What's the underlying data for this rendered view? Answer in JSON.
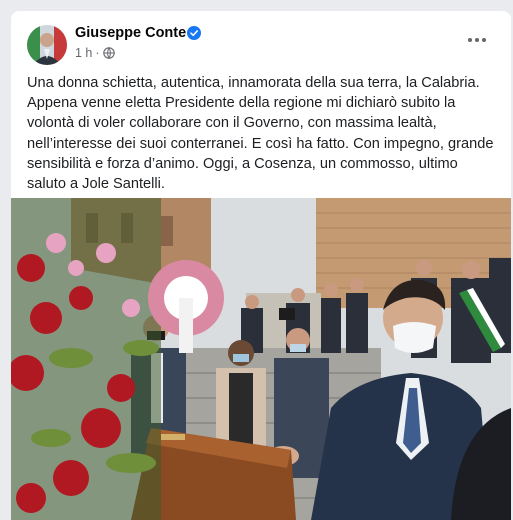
{
  "post": {
    "author": "Giuseppe Conte",
    "timestamp": "1 h",
    "separator": "·",
    "text": "Una donna schietta, autentica, innamorata della sua terra, la Calabria. Appena venne eletta Presidente della regione mi dichiarò subito la volontà di voler collaborare con il Governo, con massima lealtà, nell’interesse dei suoi conterranei. E così ha fatto. Con impegno, grande sensibilità e forza d’animo. Oggi, a Cosenza, un commosso, ultimo saluto a Jole Santelli."
  },
  "icons": {
    "verified": "verified-badge-icon",
    "privacy": "globe-icon",
    "more": "more-options-icon"
  },
  "colors": {
    "verified_blue": "#1877f2",
    "text": "#1c1e21",
    "meta": "#65676b"
  }
}
